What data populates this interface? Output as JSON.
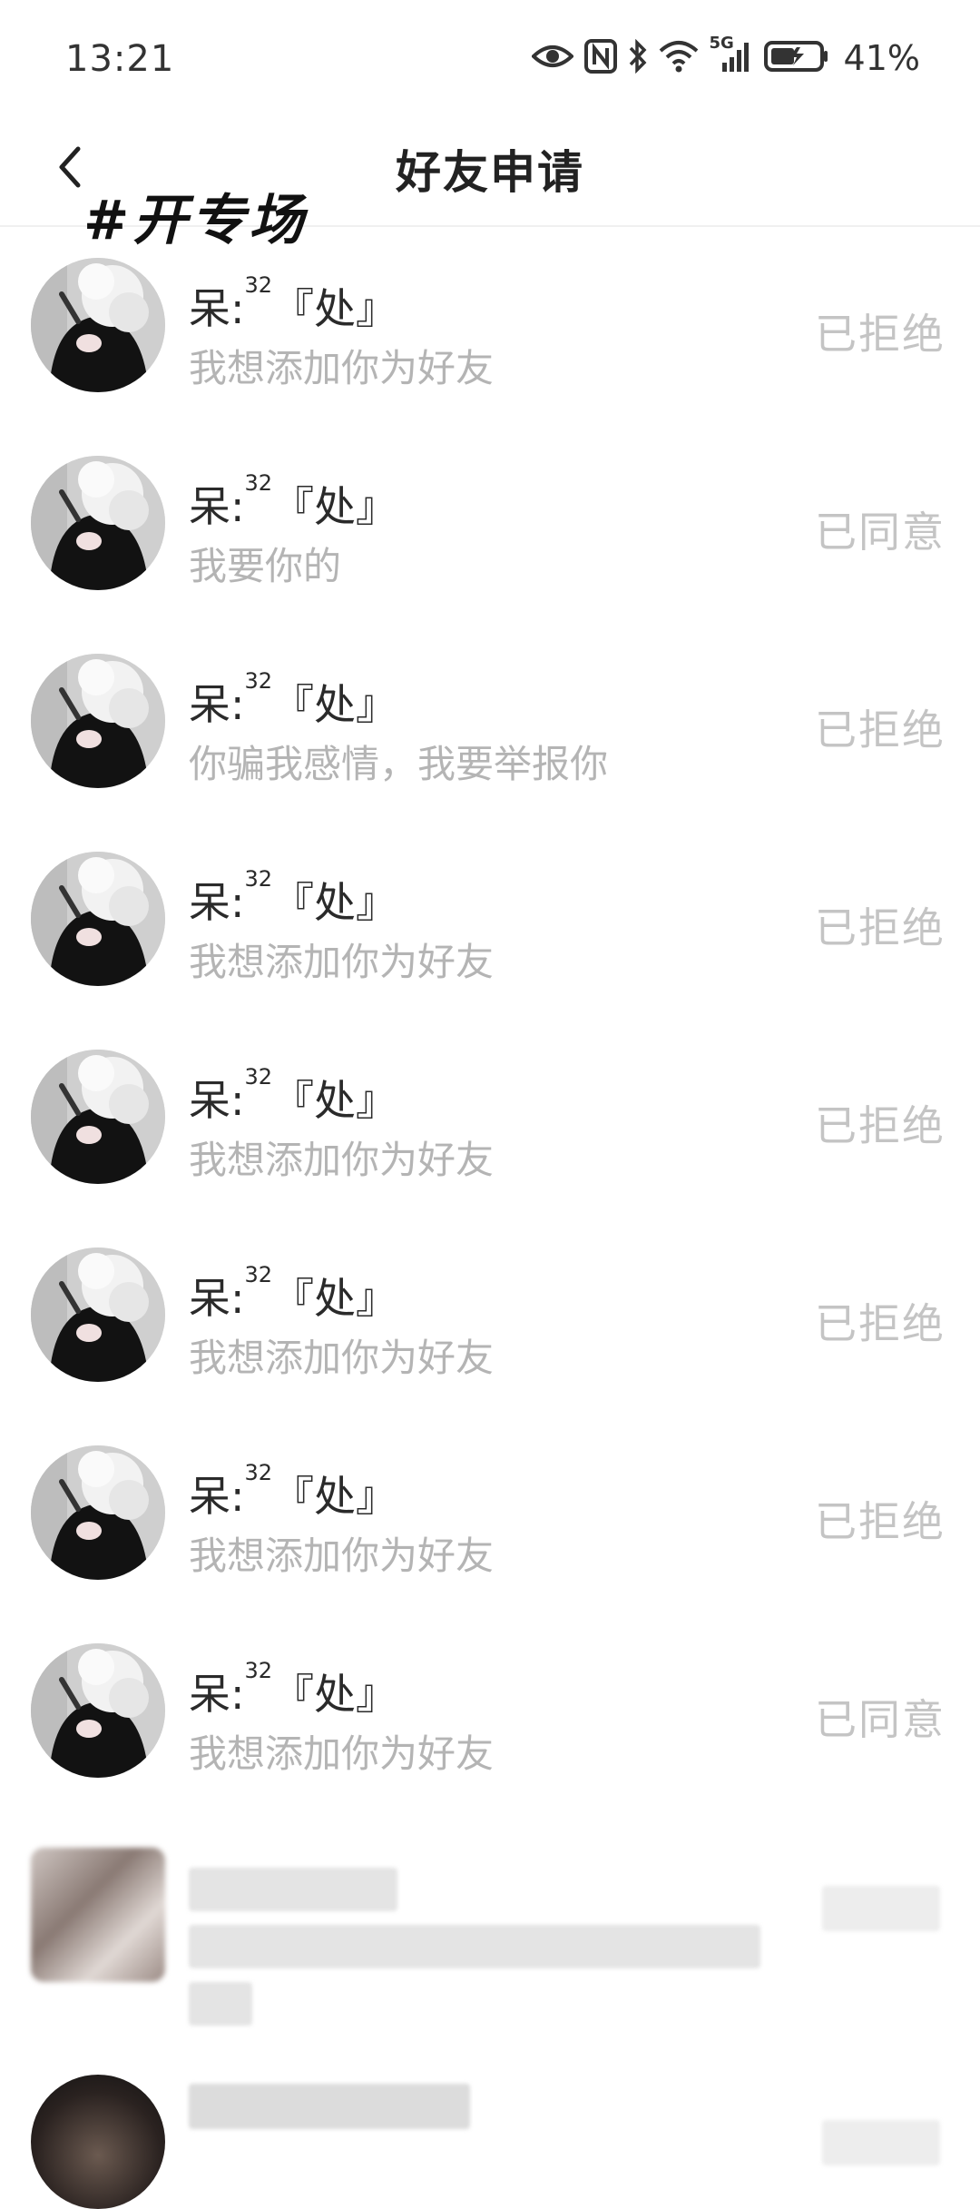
{
  "status_bar": {
    "time": "13:21",
    "network_label": "5G",
    "battery_percent": "41%",
    "icons": [
      "eye-icon",
      "nfc-icon",
      "bluetooth-icon",
      "wifi-icon",
      "signal-icon",
      "battery-charging-icon"
    ]
  },
  "header": {
    "title": "好友申请",
    "overlay_text": "#开专场",
    "back_icon": "chevron-left-icon"
  },
  "requests": [
    {
      "name": "呆:",
      "sup": "32",
      "suffix": "『处』",
      "message": "我想添加你为好友",
      "status": "已拒绝"
    },
    {
      "name": "呆:",
      "sup": "32",
      "suffix": "『处』",
      "message": "我要你的",
      "status": "已同意"
    },
    {
      "name": "呆:",
      "sup": "32",
      "suffix": "『处』",
      "message": "你骗我感情，我要举报你",
      "status": "已拒绝"
    },
    {
      "name": "呆:",
      "sup": "32",
      "suffix": "『处』",
      "message": "我想添加你为好友",
      "status": "已拒绝"
    },
    {
      "name": "呆:",
      "sup": "32",
      "suffix": "『处』",
      "message": "我想添加你为好友",
      "status": "已拒绝"
    },
    {
      "name": "呆:",
      "sup": "32",
      "suffix": "『处』",
      "message": "我想添加你为好友",
      "status": "已拒绝"
    },
    {
      "name": "呆:",
      "sup": "32",
      "suffix": "『处』",
      "message": "我想添加你为好友",
      "status": "已拒绝"
    },
    {
      "name": "呆:",
      "sup": "32",
      "suffix": "『处』",
      "message": "我想添加你为好友",
      "status": "已同意"
    }
  ]
}
